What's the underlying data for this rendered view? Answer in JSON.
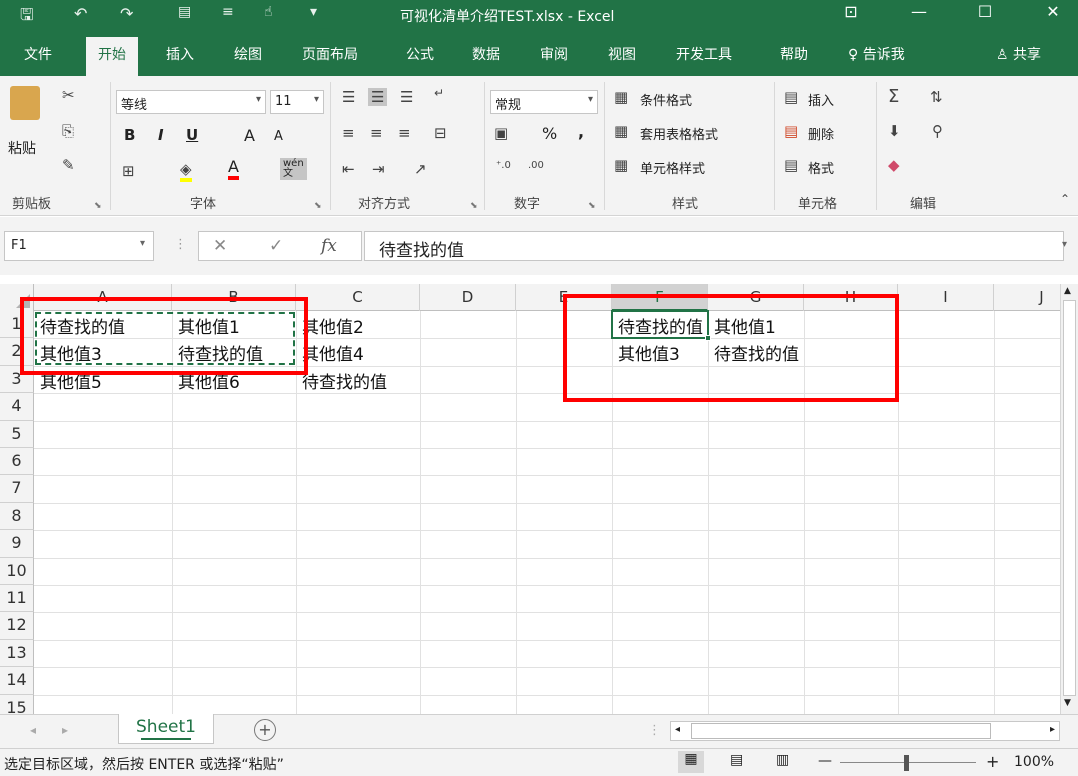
{
  "window": {
    "title": "可视化清单介绍TEST.xlsx  -  Excel",
    "controls": {
      "restore": "⊡",
      "minimize": "—",
      "maximize": "☐",
      "close": "✕"
    }
  },
  "quick_access": {
    "save_icon": "🖫",
    "undo_icon": "↶",
    "redo_icon": "↷"
  },
  "tabs": [
    "文件",
    "开始",
    "插入",
    "绘图",
    "页面布局",
    "公式",
    "数据",
    "审阅",
    "视图",
    "开发工具",
    "帮助"
  ],
  "active_tab": "开始",
  "tell_me": "告诉我",
  "share": "共享",
  "ribbon": {
    "clipboard": {
      "paste": "粘贴",
      "label": "剪贴板"
    },
    "font": {
      "name": "等线",
      "size": "11",
      "bold": "B",
      "italic": "I",
      "underline": "U",
      "grow": "A",
      "shrink": "A",
      "font_color": "A",
      "label": "字体",
      "wen": "wén"
    },
    "alignment": {
      "label": "对齐方式"
    },
    "number": {
      "format": "常规",
      "percent": "%",
      "comma": ",",
      "label": "数字"
    },
    "styles": {
      "conditional": "条件格式",
      "table": "套用表格格式",
      "cell_styles": "单元格样式",
      "label": "样式"
    },
    "cells": {
      "insert": "插入",
      "delete": "删除",
      "format": "格式",
      "label": "单元格"
    },
    "editing": {
      "label": "编辑"
    }
  },
  "formula_bar": {
    "name_box": "F1",
    "fx": "fx",
    "value": "待查找的值"
  },
  "columns": [
    "A",
    "B",
    "C",
    "D",
    "E",
    "F",
    "G",
    "H",
    "I",
    "J"
  ],
  "selected_column": "F",
  "rows": [
    "1",
    "2",
    "3",
    "4",
    "5",
    "6",
    "7",
    "8",
    "9",
    "10",
    "11",
    "12",
    "13",
    "14",
    "15"
  ],
  "cells": {
    "A1": "待查找的值",
    "B1": "其他值1",
    "C1": "其他值2",
    "A2": "其他值3",
    "B2": "待查找的值",
    "C2": "其他值4",
    "A3": "其他值5",
    "B3": "其他值6",
    "C3": "待查找的值",
    "F1": "待查找的值",
    "G1": "其他值1",
    "F2": "其他值3",
    "G2": "待查找的值"
  },
  "sheet_tabs": [
    "Sheet1"
  ],
  "add_sheet": "+",
  "status": {
    "message": "选定目标区域，然后按 ENTER 或选择“粘贴”",
    "zoom": "100%",
    "zoom_minus": "—",
    "zoom_plus": "+"
  },
  "colors": {
    "excel_green": "#217346",
    "highlight_red": "#ff0000",
    "copy_dash": "#217346"
  }
}
